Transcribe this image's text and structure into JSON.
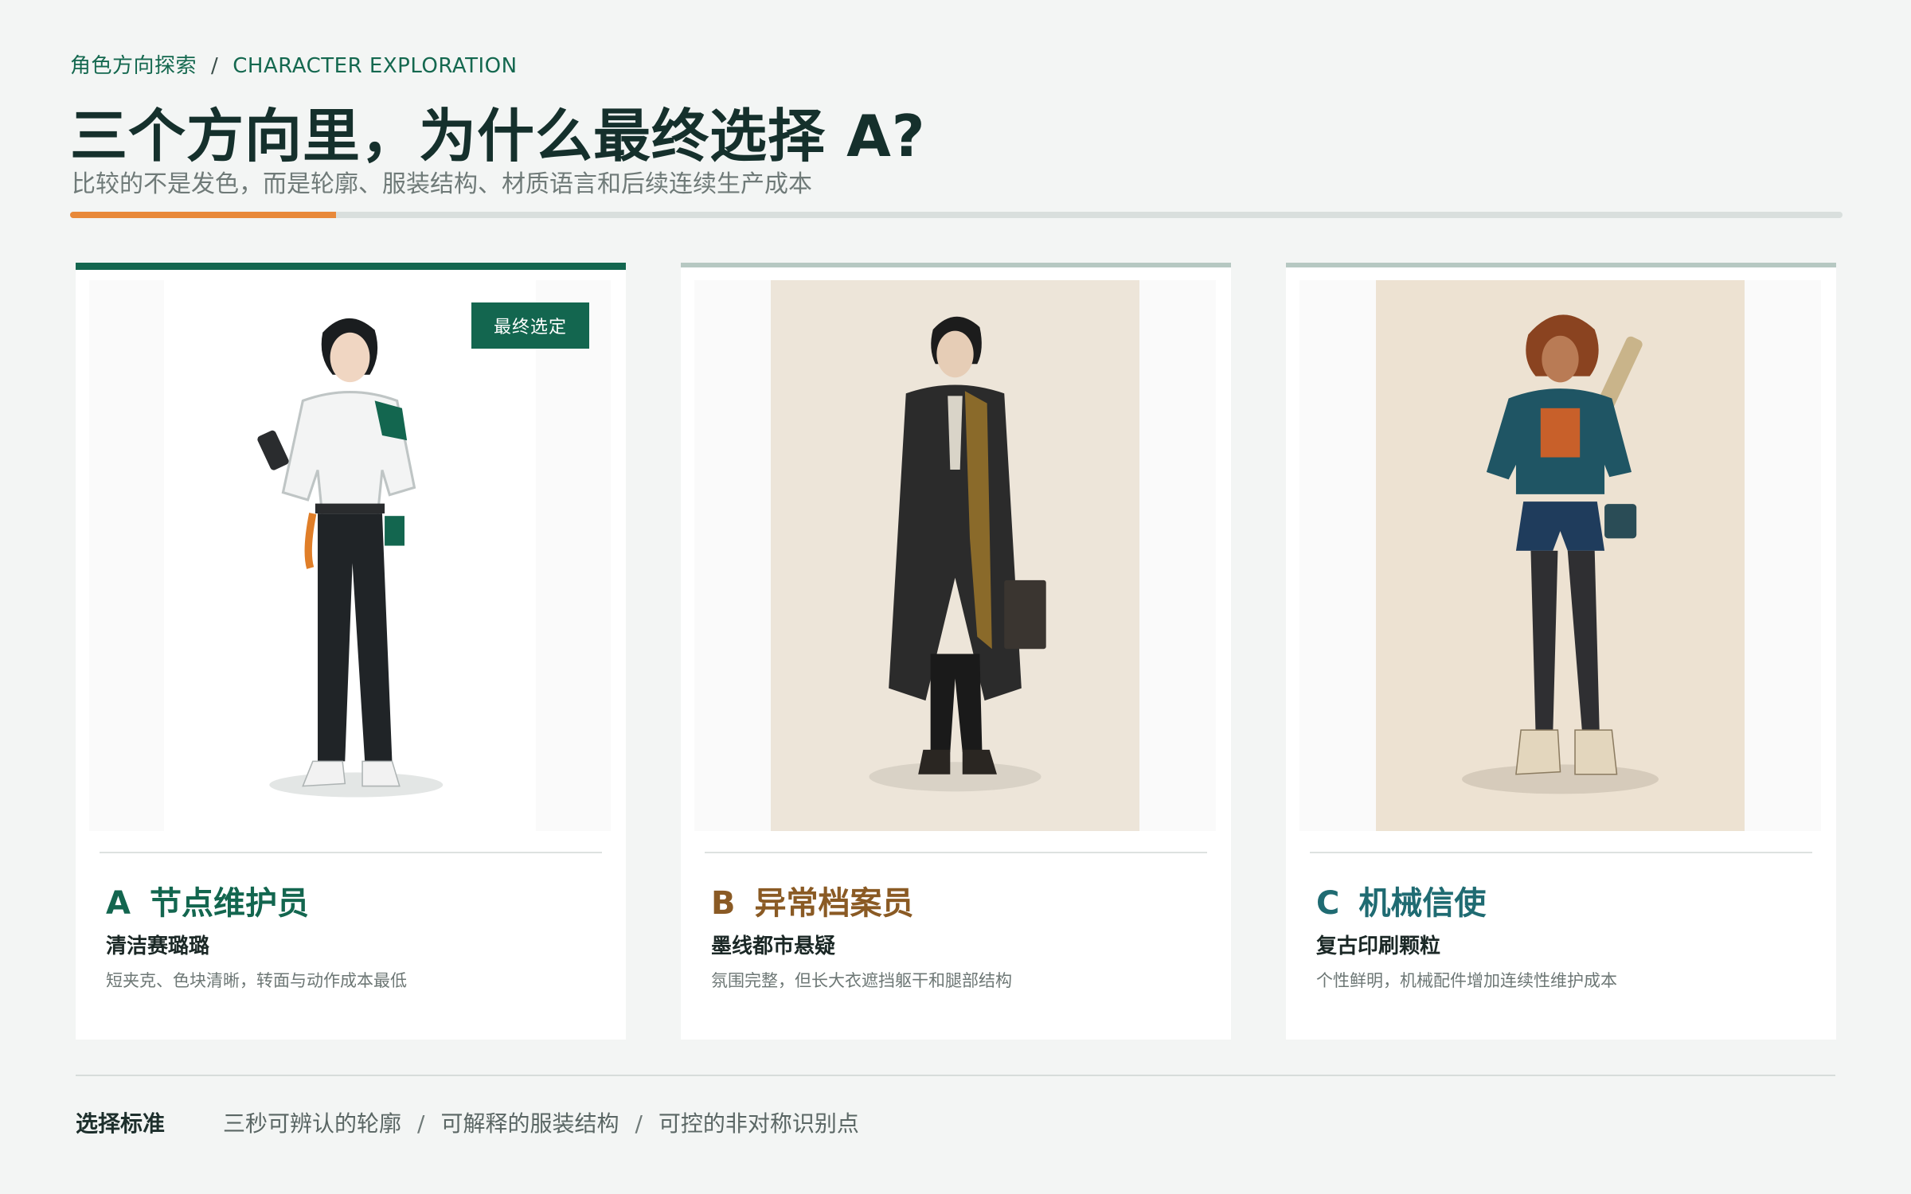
{
  "header": {
    "eyebrow_cn": "角色方向探索",
    "eyebrow_sep": "/",
    "eyebrow_en": "CHARACTER EXPLORATION",
    "title": "三个方向里，为什么最终选择 A?",
    "subtitle": "比较的不是发色，而是轮廓、服装结构、材质语言和后续连续生产成本",
    "progress_fraction": 0.15
  },
  "cards": [
    {
      "letter": "A",
      "name": "节点维护员",
      "style": "清洁赛璐璐",
      "desc": "短夹克、色块清晰，转面与动作成本最低",
      "badge": "最终选定",
      "accent": "#13664f",
      "art_bg": "#fafafa"
    },
    {
      "letter": "B",
      "name": "异常档案员",
      "style": "墨线都市悬疑",
      "desc": "氛围完整，但长大衣遮挡躯干和腿部结构",
      "accent": "#8a5a24",
      "art_bg": "#ede5d9"
    },
    {
      "letter": "C",
      "name": "机械信使",
      "style": "复古印刷颗粒",
      "desc": "个性鲜明，机械配件增加连续性维护成本",
      "accent": "#1f6b72",
      "art_bg": "#ede2d2"
    }
  ],
  "footer": {
    "label": "选择标准",
    "criteria": [
      "三秒可辨认的轮廓",
      "可解释的服装结构",
      "可控的非对称识别点"
    ],
    "sep": "/"
  }
}
